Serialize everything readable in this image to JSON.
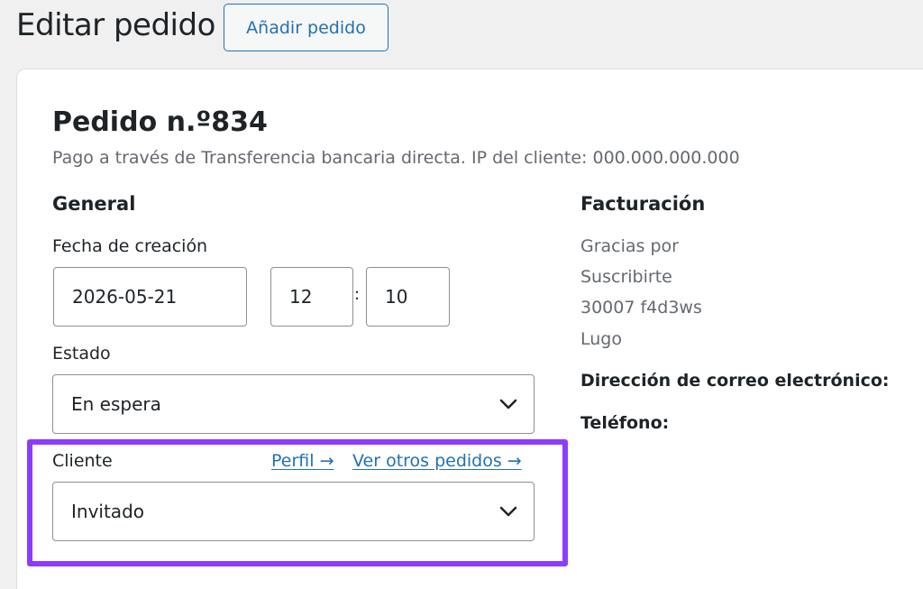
{
  "header": {
    "title": "Editar pedido",
    "add_button_label": "Añadir pedido"
  },
  "order": {
    "heading": "Pedido n.º834",
    "meta": "Pago a través de Transferencia bancaria directa. IP del cliente: 000.000.000.000"
  },
  "general": {
    "section_title": "General",
    "date_label": "Fecha de creación",
    "date_value": "2026-05-21",
    "hour_value": "12",
    "time_separator": ":",
    "minute_value": "10",
    "status_label": "Estado",
    "status_value": "En espera",
    "customer_label": "Cliente",
    "profile_link": "Perfil →",
    "other_orders_link": "Ver otros pedidos →",
    "customer_value": "Invitado"
  },
  "billing": {
    "section_title": "Facturación",
    "address_lines": [
      "Gracias por",
      "Suscribirte",
      "30007 f4d3ws",
      "Lugo"
    ],
    "email_label": "Dirección de correo electrónico:",
    "phone_label": "Teléfono:"
  },
  "colors": {
    "accent": "#2271b1",
    "highlight": "#8c3cff",
    "background": "#f0f0f1"
  },
  "icons": {
    "status_dropdown": "chevron-down-icon",
    "customer_dropdown": "chevron-down-icon"
  }
}
